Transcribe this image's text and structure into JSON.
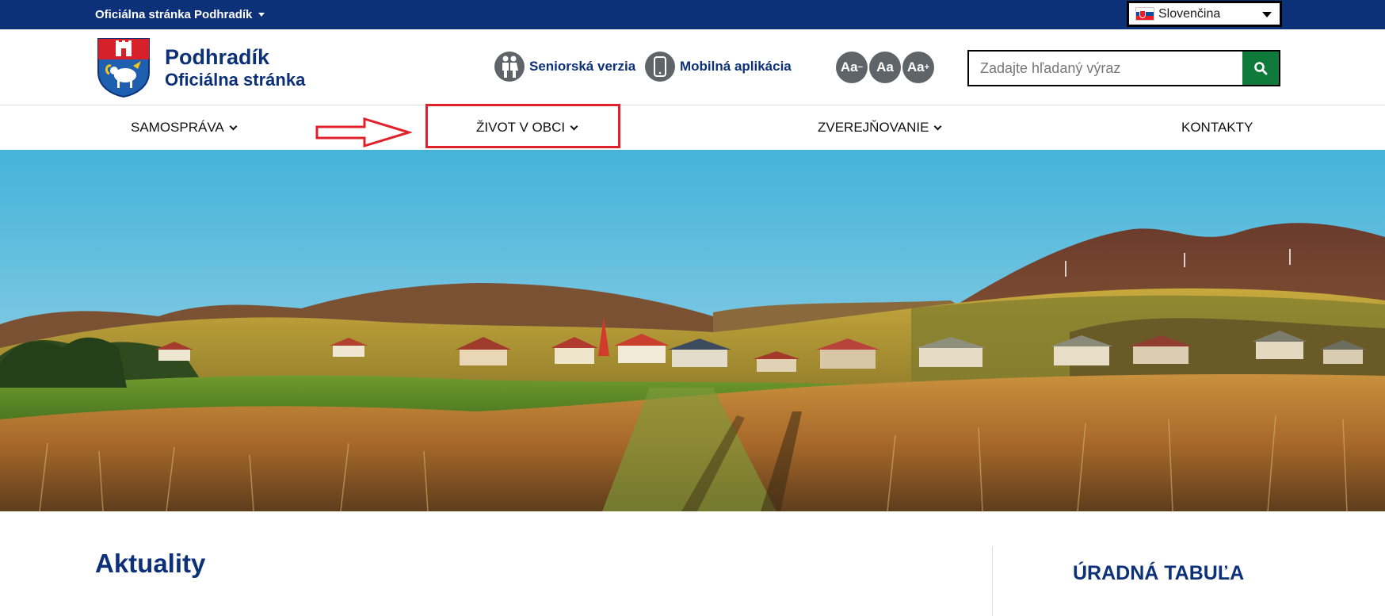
{
  "topbar": {
    "site_switch_label": "Oficiálna stránka Podhradík",
    "language": "Slovenčina",
    "colors": {
      "background": "#0d3178"
    }
  },
  "header": {
    "logo_title": "Podhradík",
    "logo_subtitle": "Oficiálna stránka",
    "senior_label": "Seniorská verzia",
    "mobile_label": "Mobilná aplikácia",
    "font_buttons": [
      "Aa",
      "Aa",
      "Aa"
    ],
    "search": {
      "placeholder": "Zadajte hľadaný výraz",
      "value": ""
    },
    "colors": {
      "brand": "#0d3178",
      "search_button": "#107a3a",
      "icon_circle": "#5f6469"
    }
  },
  "nav": {
    "items": [
      {
        "label": "SAMOSPRÁVA",
        "has_dropdown": true
      },
      {
        "label": "ŽIVOT V OBCI",
        "has_dropdown": true
      },
      {
        "label": "ZVEREJŇOVANIE",
        "has_dropdown": true
      },
      {
        "label": "KONTAKTY",
        "has_dropdown": false
      }
    ],
    "annotation": {
      "highlight_color": "#e0202a"
    }
  },
  "main": {
    "news_title": "Aktuality",
    "side_title": "ÚRADNÁ TABUĽA"
  }
}
